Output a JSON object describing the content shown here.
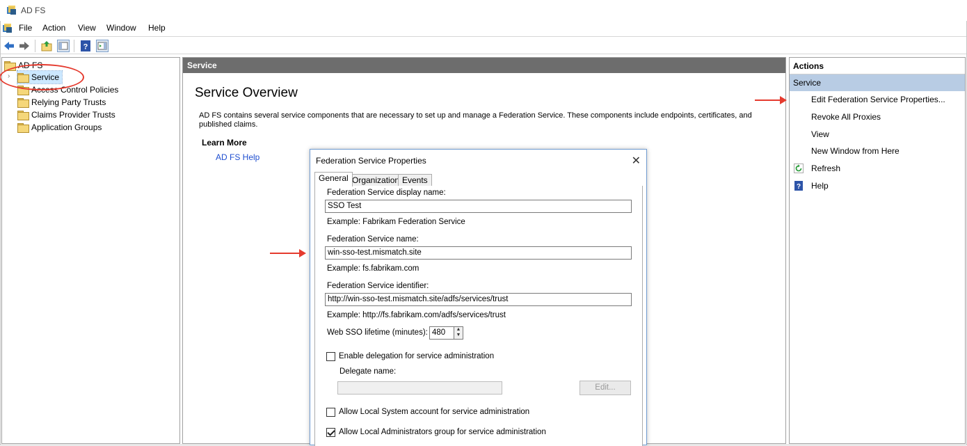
{
  "window": {
    "title": "AD FS"
  },
  "menu": [
    "File",
    "Action",
    "View",
    "Window",
    "Help"
  ],
  "toolbar": {
    "icons": [
      "back-icon",
      "forward-icon",
      "up-folder-icon",
      "show-hide-console-tree-icon",
      "help-icon",
      "show-hide-action-pane-icon"
    ]
  },
  "tree": {
    "root": "AD FS",
    "items": [
      "Service",
      "Access Control Policies",
      "Relying Party Trusts",
      "Claims Provider Trusts",
      "Application Groups"
    ],
    "selected": "Service"
  },
  "center": {
    "header": "Service",
    "title": "Service Overview",
    "description": "AD FS contains several service components that are necessary to set up and manage a Federation Service. These components include endpoints, certificates, and published claims.",
    "learn_more": "Learn More",
    "help_link": "AD FS Help"
  },
  "actions": {
    "header": "Actions",
    "section": "Service",
    "items": [
      {
        "label": "Edit Federation Service Properties...",
        "icon": ""
      },
      {
        "label": "Revoke All Proxies",
        "icon": ""
      },
      {
        "label": "View",
        "icon": ""
      },
      {
        "label": "New Window from Here",
        "icon": ""
      },
      {
        "label": "Refresh",
        "icon": "refresh-icon"
      },
      {
        "label": "Help",
        "icon": "help-icon"
      }
    ]
  },
  "dialog": {
    "title": "Federation Service Properties",
    "tabs": [
      "General",
      "Organization",
      "Events"
    ],
    "active_tab": "General",
    "display_name_label": "Federation Service display name:",
    "display_name_value": "SSO Test",
    "display_name_example": "Example: Fabrikam Federation Service",
    "service_name_label": "Federation Service name:",
    "service_name_value": "win-sso-test.mismatch.site",
    "service_name_example": "Example: fs.fabrikam.com",
    "identifier_label": "Federation Service identifier:",
    "identifier_value": "http://win-sso-test.mismatch.site/adfs/services/trust",
    "identifier_example": "Example: http://fs.fabrikam.com/adfs/services/trust",
    "sso_lifetime_label": "Web SSO lifetime (minutes):",
    "sso_lifetime_value": "480",
    "enable_delegation_label": "Enable delegation for service administration",
    "enable_delegation_checked": false,
    "delegate_name_label": "Delegate name:",
    "delegate_name_value": "",
    "edit_button": "Edit...",
    "allow_local_system_label": "Allow Local System account for service administration",
    "allow_local_system_checked": false,
    "allow_local_admins_label": "Allow Local Administrators group for service administration",
    "allow_local_admins_checked": true
  },
  "colors": {
    "annotation_red": "#e53a2e",
    "action_section_bg": "#b8cce4",
    "pane_header_bg": "#6d6d6d",
    "link_blue": "#1f4fd0"
  }
}
